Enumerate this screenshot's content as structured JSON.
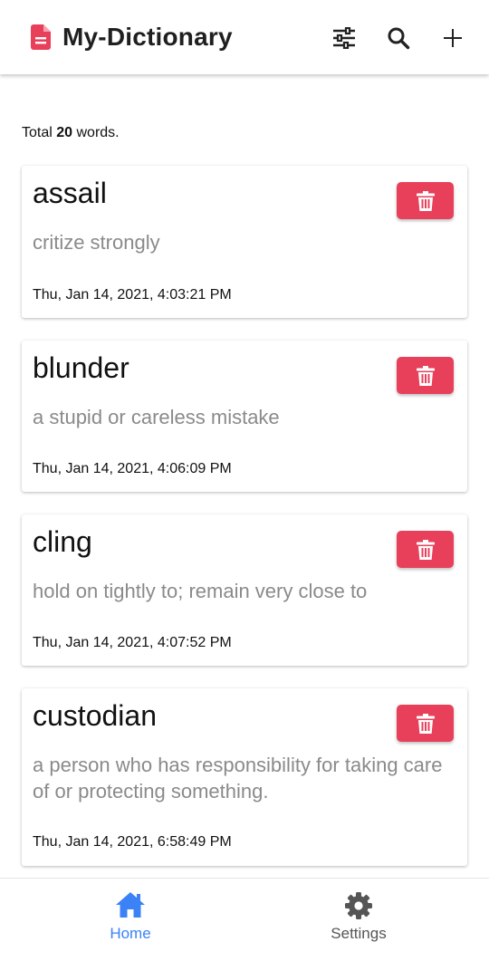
{
  "app": {
    "title": "My-Dictionary",
    "brand_color": "#e8405a",
    "logo_icon": "document-icon"
  },
  "toolbar": {
    "filter_icon": "sliders-icon",
    "search_icon": "search-icon",
    "add_icon": "plus-icon"
  },
  "summary": {
    "prefix": "Total",
    "count": "20",
    "suffix": "words."
  },
  "words": [
    {
      "word": "assail",
      "meaning": "critize strongly",
      "date": "Thu, Jan 14, 2021, 4:03:21 PM"
    },
    {
      "word": "blunder",
      "meaning": "a stupid or careless mistake",
      "date": "Thu, Jan 14, 2021, 4:06:09 PM"
    },
    {
      "word": "cling",
      "meaning": "hold on tightly to; remain very close to",
      "date": "Thu, Jan 14, 2021, 4:07:52 PM"
    },
    {
      "word": "custodian",
      "meaning": "a person who has responsibility for taking care of or protecting something.",
      "date": "Thu, Jan 14, 2021, 6:58:49 PM"
    }
  ],
  "delete_button_color": "#e8405a",
  "nav": {
    "home_label": "Home",
    "settings_label": "Settings",
    "active_color": "#3b82f6",
    "inactive_color": "#555555"
  }
}
